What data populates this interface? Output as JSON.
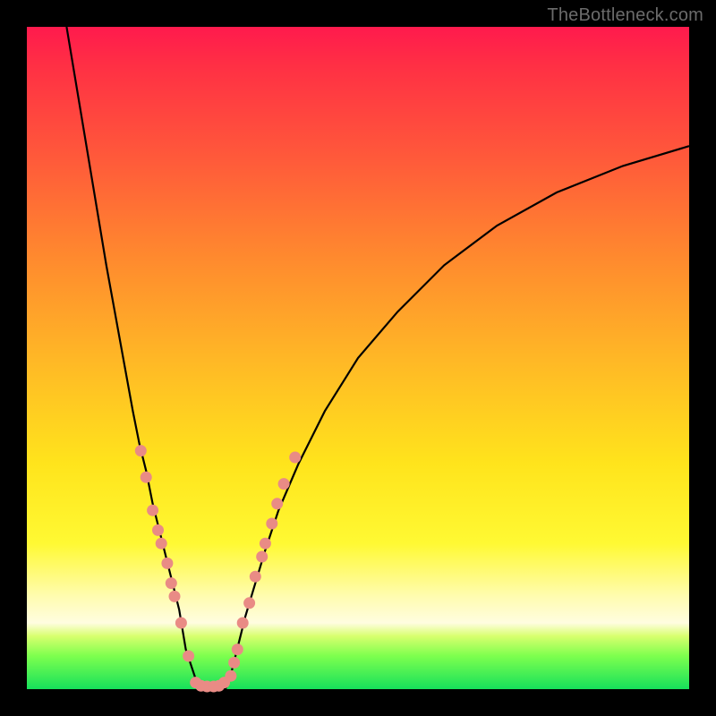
{
  "watermark": "TheBottleneck.com",
  "colors": {
    "background": "#000000",
    "gradient_top": "#ff1a4d",
    "gradient_bottom": "#16e05b",
    "curve": "#000000",
    "dots": "#e98b85"
  },
  "chart_data": {
    "type": "line",
    "title": "",
    "xlabel": "",
    "ylabel": "",
    "xlim": [
      0,
      100
    ],
    "ylim": [
      0,
      100
    ],
    "curve_left": {
      "x": [
        6,
        8,
        10,
        12,
        14,
        16,
        17,
        18,
        19,
        20,
        21,
        22,
        23,
        23.5,
        24,
        25,
        25.5,
        26
      ],
      "y": [
        100,
        88,
        76,
        64,
        53,
        42,
        37,
        33,
        28,
        24,
        20,
        16,
        12,
        9,
        6,
        3,
        1.5,
        0
      ]
    },
    "curve_right": {
      "x": [
        30,
        30.5,
        31,
        32,
        33,
        34.5,
        36,
        38,
        41,
        45,
        50,
        56,
        63,
        71,
        80,
        90,
        100
      ],
      "y": [
        0,
        1.5,
        3,
        7,
        11,
        16,
        21,
        27,
        34,
        42,
        50,
        57,
        64,
        70,
        75,
        79,
        82
      ]
    },
    "floor_segment": {
      "x": [
        26,
        30
      ],
      "y": [
        0,
        0
      ]
    },
    "dots_left": [
      {
        "x": 17.2,
        "y": 36
      },
      {
        "x": 18.0,
        "y": 32
      },
      {
        "x": 19.0,
        "y": 27
      },
      {
        "x": 19.8,
        "y": 24
      },
      {
        "x": 20.3,
        "y": 22
      },
      {
        "x": 21.2,
        "y": 19
      },
      {
        "x": 21.8,
        "y": 16
      },
      {
        "x": 22.3,
        "y": 14
      },
      {
        "x": 23.3,
        "y": 10
      },
      {
        "x": 24.4,
        "y": 5
      }
    ],
    "dots_right": [
      {
        "x": 30.8,
        "y": 2
      },
      {
        "x": 31.3,
        "y": 4
      },
      {
        "x": 31.8,
        "y": 6
      },
      {
        "x": 32.6,
        "y": 10
      },
      {
        "x": 33.6,
        "y": 13
      },
      {
        "x": 34.5,
        "y": 17
      },
      {
        "x": 35.5,
        "y": 20
      },
      {
        "x": 36.0,
        "y": 22
      },
      {
        "x": 37.0,
        "y": 25
      },
      {
        "x": 37.8,
        "y": 28
      },
      {
        "x": 38.8,
        "y": 31
      },
      {
        "x": 40.5,
        "y": 35
      }
    ],
    "dots_bottom": [
      {
        "x": 25.5,
        "y": 1
      },
      {
        "x": 26.3,
        "y": 0.5
      },
      {
        "x": 27.2,
        "y": 0.4
      },
      {
        "x": 28.2,
        "y": 0.4
      },
      {
        "x": 29.0,
        "y": 0.5
      },
      {
        "x": 29.8,
        "y": 1
      }
    ]
  }
}
